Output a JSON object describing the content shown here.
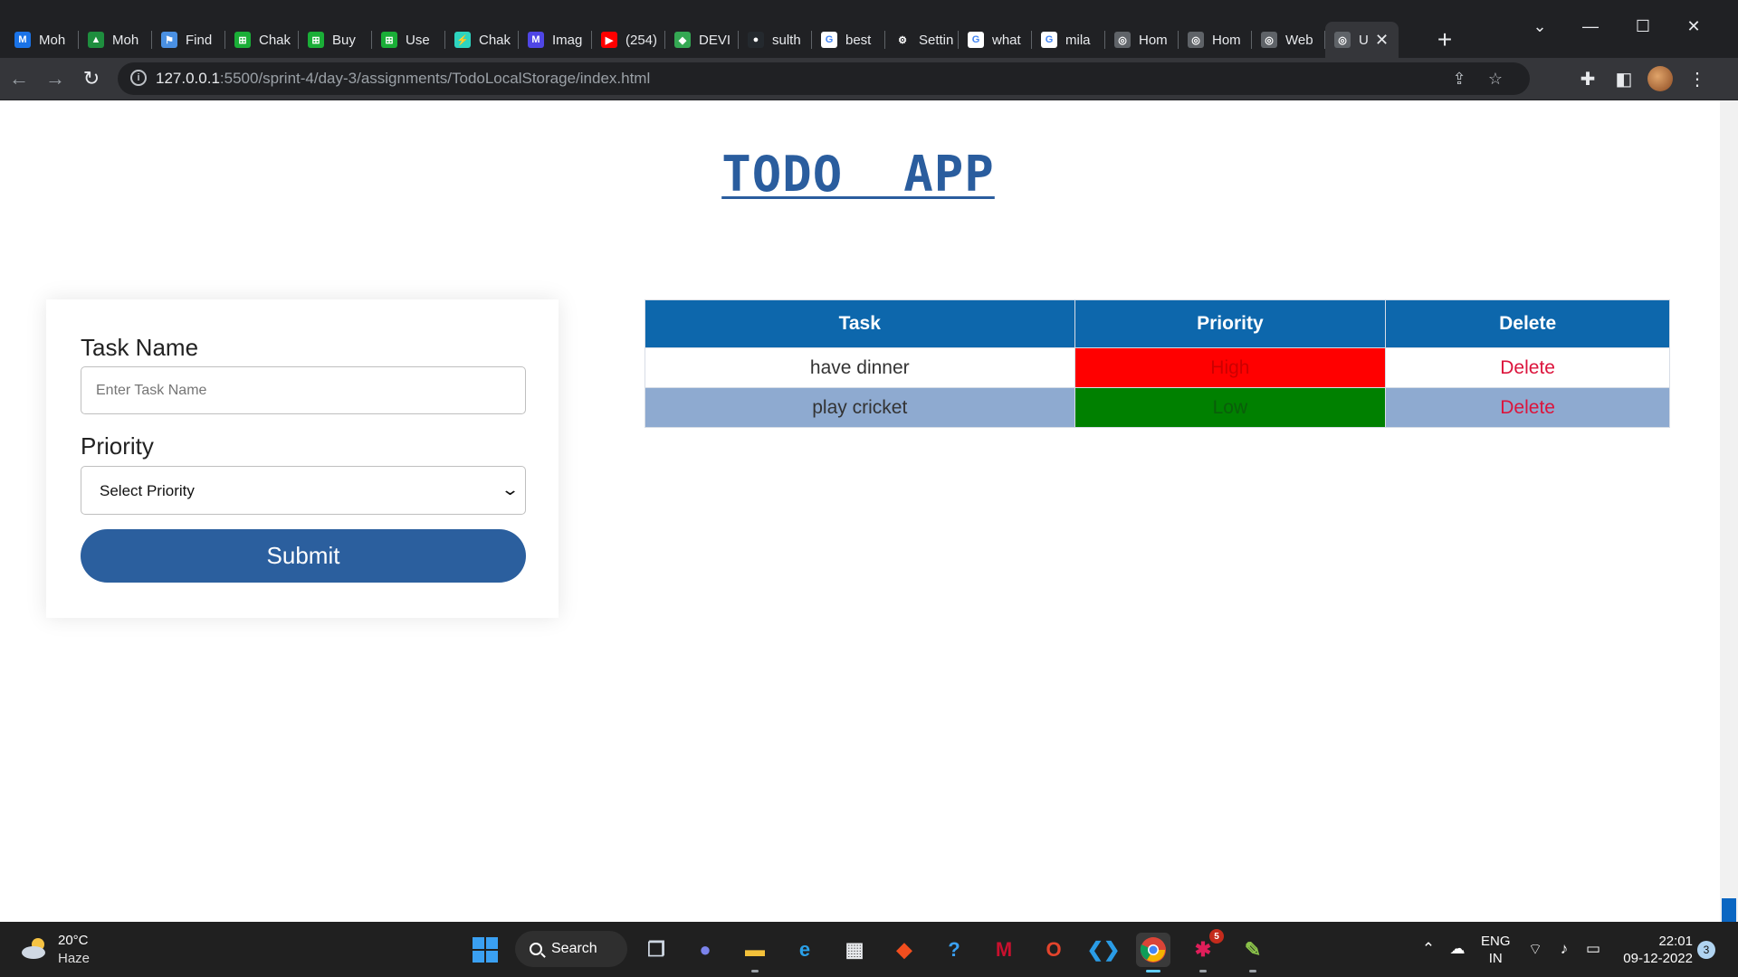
{
  "browser": {
    "tabs": [
      {
        "title": "Moh",
        "icon": "gmail-icon",
        "color": "#1a73e8",
        "glyph": "M"
      },
      {
        "title": "Moh",
        "icon": "google-drive-icon",
        "color": "#1e8e3e",
        "glyph": "▲"
      },
      {
        "title": "Find",
        "icon": "flag-icon",
        "color": "#4a90e2",
        "glyph": "⚑"
      },
      {
        "title": "Chak",
        "icon": "chakra-icon",
        "color": "#1aae37",
        "glyph": "⊞"
      },
      {
        "title": "Buy",
        "icon": "chakra-icon",
        "color": "#1aae37",
        "glyph": "⊞"
      },
      {
        "title": "Use",
        "icon": "chakra-icon",
        "color": "#1aae37",
        "glyph": "⊞"
      },
      {
        "title": "Chak",
        "icon": "chakra-ui-icon",
        "color": "#2dd4bf",
        "glyph": "⚡"
      },
      {
        "title": "Imag",
        "icon": "image-icon",
        "color": "#4f46e5",
        "glyph": "M"
      },
      {
        "title": "(254)",
        "icon": "youtube-icon",
        "color": "#ff0000",
        "glyph": "▶"
      },
      {
        "title": "DEVI",
        "icon": "shield-icon",
        "color": "#34a853",
        "glyph": "◆"
      },
      {
        "title": "sulth",
        "icon": "github-icon",
        "color": "#24292e",
        "glyph": "●"
      },
      {
        "title": "best",
        "icon": "google-icon",
        "color": "#ffffff",
        "glyph": "G"
      },
      {
        "title": "Settin",
        "icon": "settings-gear-icon",
        "color": "#202124",
        "glyph": "⚙"
      },
      {
        "title": "what",
        "icon": "google-icon",
        "color": "#ffffff",
        "glyph": "G"
      },
      {
        "title": "mila",
        "icon": "google-icon",
        "color": "#ffffff",
        "glyph": "G"
      },
      {
        "title": "Hom",
        "icon": "globe-icon",
        "color": "#5f6368",
        "glyph": "◎"
      },
      {
        "title": "Hom",
        "icon": "globe-icon",
        "color": "#5f6368",
        "glyph": "◎"
      },
      {
        "title": "Web",
        "icon": "globe-icon",
        "color": "#5f6368",
        "glyph": "◎"
      },
      {
        "title": "U",
        "icon": "globe-icon",
        "color": "#5f6368",
        "glyph": "◎",
        "active": true
      }
    ],
    "url_host": "127.0.0.1",
    "url_path": ":5500/sprint-4/day-3/assignments/TodoLocalStorage/index.html"
  },
  "app": {
    "title": "TODO  APP",
    "form": {
      "task_label": "Task Name",
      "task_placeholder": "Enter Task Name",
      "task_value": "",
      "priority_label": "Priority",
      "priority_selected": "Select Priority",
      "submit_label": "Submit"
    },
    "table": {
      "headers": [
        "Task",
        "Priority",
        "Delete"
      ],
      "rows": [
        {
          "task": "have dinner",
          "priority": "High",
          "delete": "Delete"
        },
        {
          "task": "play cricket",
          "priority": "Low",
          "delete": "Delete"
        }
      ]
    },
    "colors": {
      "title": "#2a5d9e",
      "header_bg": "#0d67ac",
      "submit_bg": "#2b5f9e",
      "high_bg": "#ff0000",
      "low_bg": "#008000",
      "even_row_bg": "#8eaad0",
      "delete_text": "#dc143c"
    }
  },
  "taskbar": {
    "weather_temp": "20°C",
    "weather_desc": "Haze",
    "search_label": "Search",
    "lang_line1": "ENG",
    "lang_line2": "IN",
    "time": "22:01",
    "date": "09-12-2022",
    "notification_count": "3",
    "slack_badge": "5"
  }
}
